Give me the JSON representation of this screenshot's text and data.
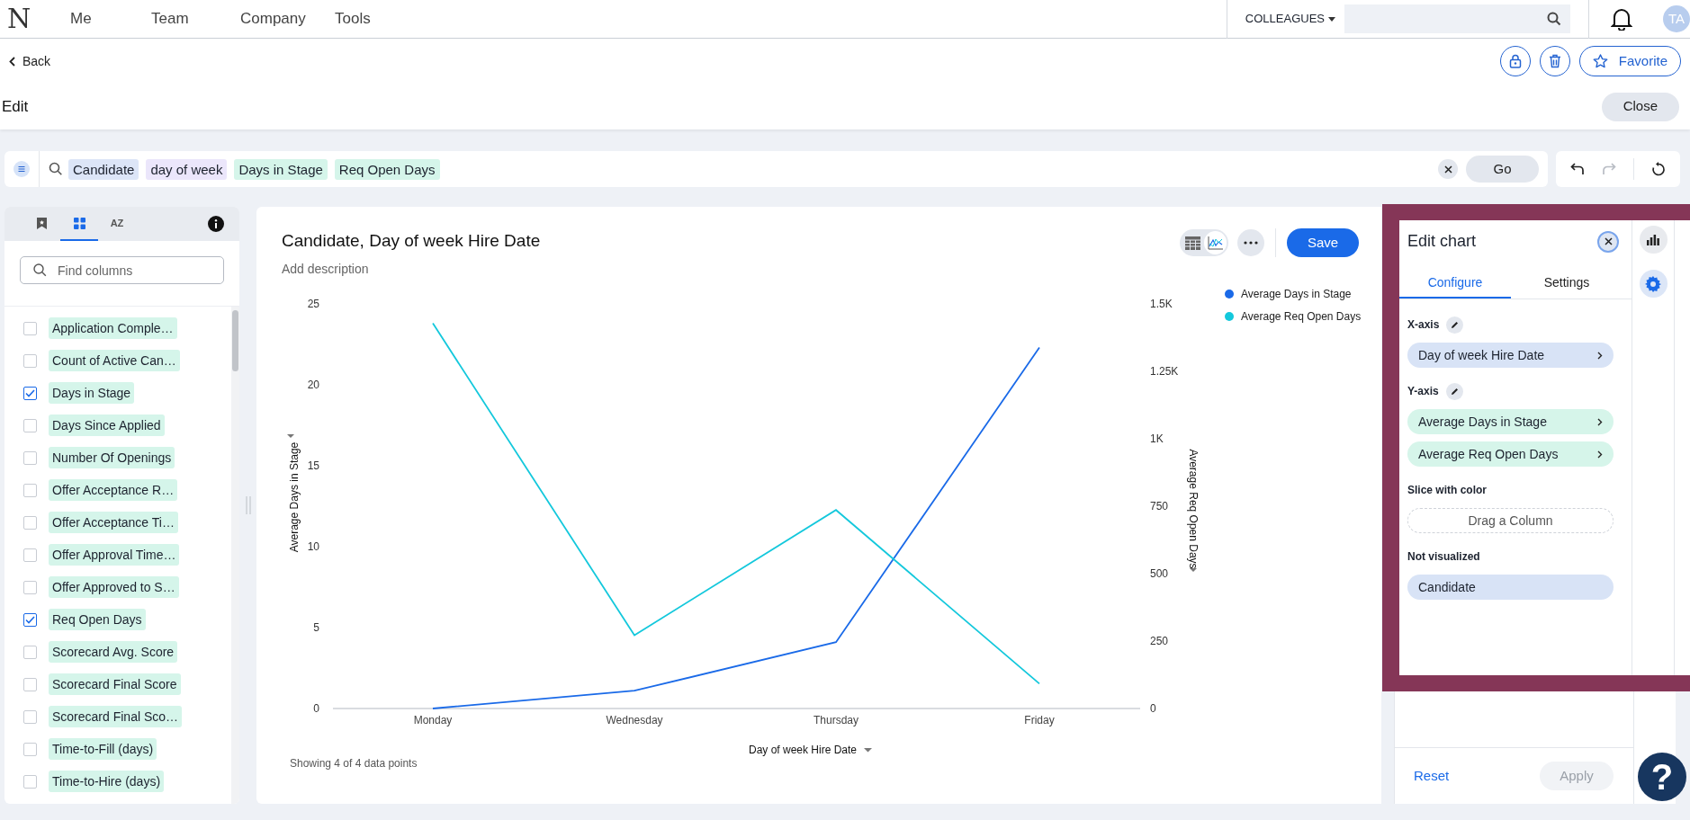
{
  "nav": {
    "logo": "N",
    "items": [
      {
        "label": "Me"
      },
      {
        "label": "Team"
      },
      {
        "label": "Company"
      },
      {
        "label": "Tools"
      }
    ],
    "scope": "COLLEAGUES",
    "avatar": "TA"
  },
  "header": {
    "back": "Back",
    "favorite": "Favorite",
    "title": "Edit",
    "close": "Close"
  },
  "search": {
    "tokens": [
      {
        "label": "Candidate",
        "color": "#dce5f7"
      },
      {
        "label": "day of week",
        "color": "#ebe6fb"
      },
      {
        "label": "Days in Stage",
        "color": "#d5f5ea"
      },
      {
        "label": "Req Open Days",
        "color": "#d5f5ea"
      }
    ],
    "go": "Go"
  },
  "columns_panel": {
    "tabs": [
      {
        "kind": "bookmark",
        "selected": false
      },
      {
        "kind": "grid",
        "selected": true
      },
      {
        "kind": "sort",
        "label": "AZ",
        "selected": false
      }
    ],
    "placeholder": "Find columns",
    "items": [
      {
        "label": "Application Comple…",
        "checked": false
      },
      {
        "label": "Count of Active Can…",
        "checked": false
      },
      {
        "label": "Days in Stage",
        "checked": true
      },
      {
        "label": "Days Since Applied",
        "checked": false
      },
      {
        "label": "Number Of Openings",
        "checked": false
      },
      {
        "label": "Offer Acceptance R…",
        "checked": false
      },
      {
        "label": "Offer Acceptance Ti…",
        "checked": false
      },
      {
        "label": "Offer Approval Time…",
        "checked": false
      },
      {
        "label": "Offer Approved to S…",
        "checked": false
      },
      {
        "label": "Req Open Days",
        "checked": true
      },
      {
        "label": "Scorecard Avg. Score",
        "checked": false
      },
      {
        "label": "Scorecard Final Score",
        "checked": false
      },
      {
        "label": "Scorecard Final Sco…",
        "checked": false
      },
      {
        "label": "Time-to-Fill (days)",
        "checked": false
      },
      {
        "label": "Time-to-Hire (days)",
        "checked": false
      }
    ]
  },
  "chart_card": {
    "title": "Candidate, Day of week Hire Date",
    "description_placeholder": "Add description",
    "save": "Save",
    "views": [
      {
        "kind": "table",
        "selected": false
      },
      {
        "kind": "chart",
        "selected": true
      }
    ],
    "footer": "Showing 4 of 4 data points",
    "chart_data": {
      "type": "line",
      "xlabel": "Day of week Hire Date",
      "ylabel": "Average Days in Stage",
      "y2label": "Average Req Open Days",
      "legend": "top-right",
      "categories": [
        "Monday",
        "Wednesday",
        "Thursday",
        "Friday"
      ],
      "series": [
        {
          "name": "Average Days in Stage",
          "color": "#1a6ae8",
          "values": [
            0,
            1.1,
            4.1,
            22.3
          ]
        },
        {
          "name": "Average Req Open Days",
          "color": "#14c8dc",
          "axis": "y2",
          "values": [
            1428,
            272,
            736,
            92
          ]
        }
      ],
      "ylim": [
        0,
        25
      ],
      "yticks": [
        0,
        5,
        10,
        15,
        20,
        25
      ],
      "y2lim": [
        0,
        1500
      ],
      "y2ticks": [
        0,
        250,
        500,
        750,
        {
          "value": 1000,
          "label": "1K"
        },
        {
          "value": 1250,
          "label": "1.25K"
        },
        {
          "value": 1500,
          "label": "1.5K"
        }
      ]
    }
  },
  "edit_chart": {
    "title": "Edit chart",
    "tabs": [
      {
        "label": "Configure",
        "selected": true
      },
      {
        "label": "Settings",
        "selected": false
      }
    ],
    "sections": [
      {
        "label": "X-axis",
        "editable": true,
        "chips": [
          {
            "label": "Day of week Hire Date",
            "kind": "attribute"
          }
        ]
      },
      {
        "label": "Y-axis",
        "editable": true,
        "chips": [
          {
            "label": "Average Days in Stage",
            "kind": "measure"
          },
          {
            "label": "Average Req Open Days",
            "kind": "measure"
          }
        ]
      },
      {
        "label": "Slice with color",
        "editable": false,
        "chips": [
          {
            "label": "Drag a Column",
            "kind": "dropzone"
          }
        ]
      },
      {
        "label": "Not visualized",
        "editable": false,
        "chips": [
          {
            "label": "Candidate",
            "kind": "plain"
          }
        ]
      }
    ],
    "side": [
      {
        "kind": "chart",
        "selected": false
      },
      {
        "kind": "settings",
        "selected": true
      }
    ],
    "reset": "Reset",
    "apply": "Apply",
    "apply_disabled": true
  },
  "help": "?"
}
